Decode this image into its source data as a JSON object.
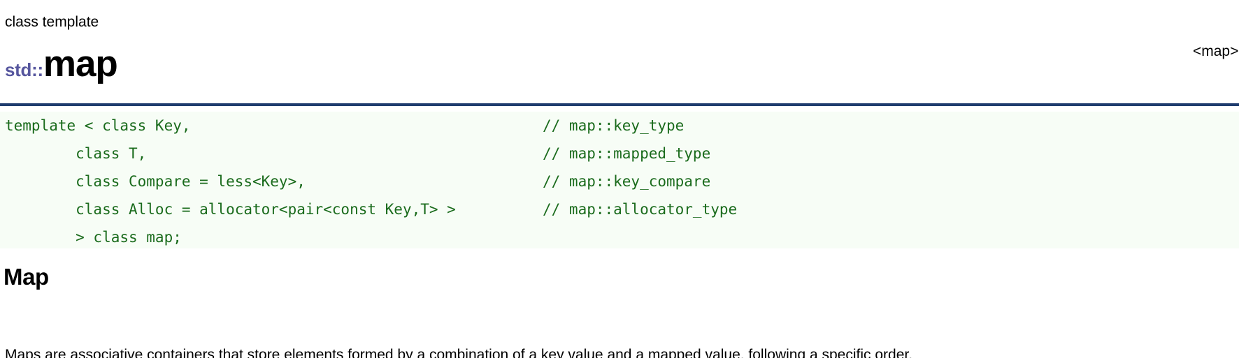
{
  "header": {
    "kind": "class template",
    "namespace": "std::",
    "name": "map",
    "header_ref": "<map>"
  },
  "colors": {
    "namespace_purple": "#56569e",
    "rule_navy": "#1f3c6e",
    "code_green": "#1a6b1c",
    "code_background": "#f7fdf6",
    "page_background": "#ffffff",
    "text_black": "#000000"
  },
  "code_block": {
    "language": "cpp",
    "lines": [
      {
        "code": "template < class Key,",
        "comment": "// map::key_type"
      },
      {
        "code": "        class T,",
        "comment": "// map::mapped_type"
      },
      {
        "code": "        class Compare = less<Key>,",
        "comment": "// map::key_compare"
      },
      {
        "code": "        class Alloc = allocator<pair<const Key,T> >",
        "comment": "// map::allocator_type"
      },
      {
        "code": "        > class map;",
        "comment": ""
      }
    ]
  },
  "sections": [
    {
      "heading": "Map",
      "paragraph": "Maps are associative containers that store elements formed by a combination of a key value and a mapped value, following a specific order."
    }
  ]
}
